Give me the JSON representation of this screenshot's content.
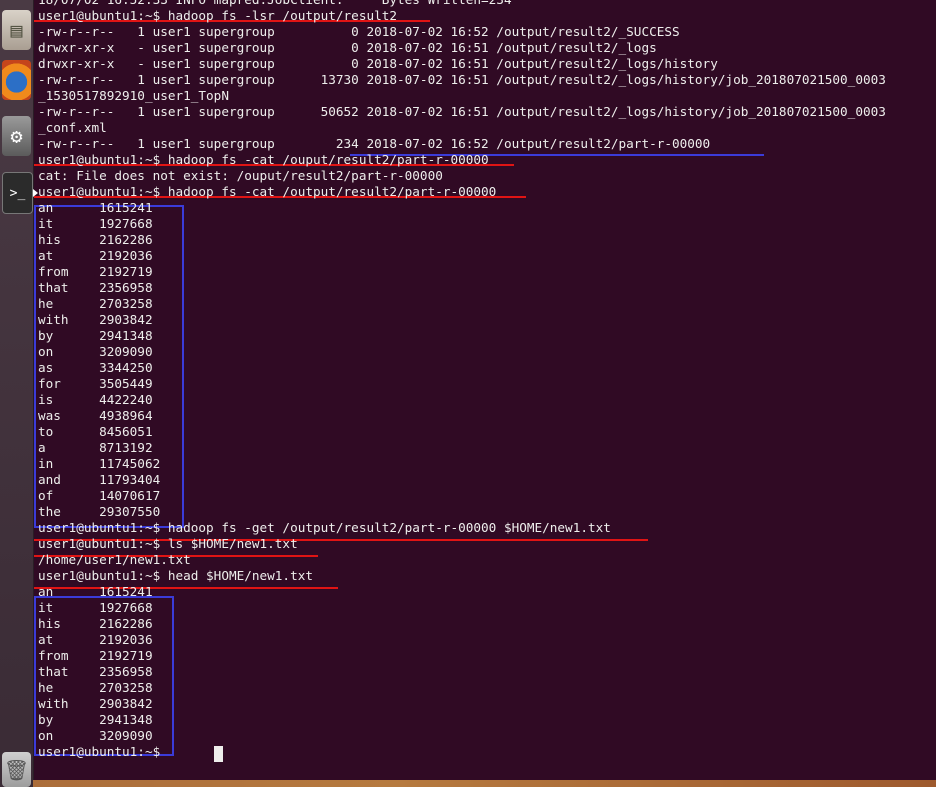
{
  "launcher": {
    "icons": [
      "files-icon",
      "firefox-icon",
      "settings-icon",
      "terminal-icon",
      "trash-icon"
    ],
    "terminal_glyph": ">_"
  },
  "terminal": {
    "prompt": "user1@ubuntu1:~$",
    "lines": [
      "18/07/02 16:52:33 INFO mapred.JobClient:     Bytes Written=234",
      "user1@ubuntu1:~$ hadoop fs -lsr /output/result2",
      "-rw-r--r--   1 user1 supergroup          0 2018-07-02 16:52 /output/result2/_SUCCESS",
      "drwxr-xr-x   - user1 supergroup          0 2018-07-02 16:51 /output/result2/_logs",
      "drwxr-xr-x   - user1 supergroup          0 2018-07-02 16:51 /output/result2/_logs/history",
      "-rw-r--r--   1 user1 supergroup      13730 2018-07-02 16:51 /output/result2/_logs/history/job_201807021500_0003",
      "_1530517892910_user1_TopN",
      "-rw-r--r--   1 user1 supergroup      50652 2018-07-02 16:51 /output/result2/_logs/history/job_201807021500_0003",
      "_conf.xml",
      "-rw-r--r--   1 user1 supergroup        234 2018-07-02 16:52 /output/result2/part-r-00000",
      "user1@ubuntu1:~$ hadoop fs -cat /ouput/result2/part-r-00000",
      "cat: File does not exist: /ouput/result2/part-r-00000",
      "user1@ubuntu1:~$ hadoop fs -cat /output/result2/part-r-00000",
      "an      1615241",
      "it      1927668",
      "his     2162286",
      "at      2192036",
      "from    2192719",
      "that    2356958",
      "he      2703258",
      "with    2903842",
      "by      2941348",
      "on      3209090",
      "as      3344250",
      "for     3505449",
      "is      4422240",
      "was     4938964",
      "to      8456051",
      "a       8713192",
      "in      11745062",
      "and     11793404",
      "of      14070617",
      "the     29307550",
      "user1@ubuntu1:~$ hadoop fs -get /output/result2/part-r-00000 $HOME/new1.txt",
      "user1@ubuntu1:~$ ls $HOME/new1.txt",
      "/home/user1/new1.txt",
      "user1@ubuntu1:~$ head $HOME/new1.txt",
      "an      1615241",
      "it      1927668",
      "his     2162286",
      "at      2192036",
      "from    2192719",
      "that    2356958",
      "he      2703258",
      "with    2903842",
      "by      2941348",
      "on      3209090",
      "user1@ubuntu1:~$ "
    ]
  }
}
